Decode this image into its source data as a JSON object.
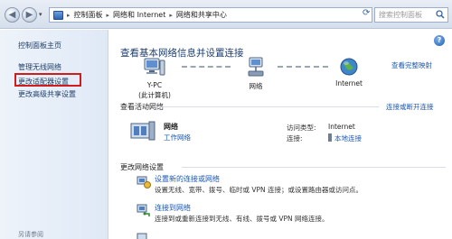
{
  "address_bar": {
    "segments": [
      "控制面板",
      "网络和 Internet",
      "网络和共享中心"
    ],
    "search_placeholder": "搜索控制面板"
  },
  "sidebar": {
    "items": [
      {
        "label": "控制面板主页"
      },
      {
        "label": "管理无线网络"
      },
      {
        "label": "更改适配器设置",
        "highlighted": true
      },
      {
        "label": "更改高级共享设置"
      }
    ],
    "see_also": "另请参阅"
  },
  "main": {
    "title": "查看基本网络信息并设置连接",
    "full_map_link": "查看完整映射",
    "map_nodes": {
      "pc_name": "Y-PC",
      "pc_sub": "(此计算机)",
      "network": "网络",
      "internet": "Internet"
    },
    "active_section": "查看活动网络",
    "disconnect_link": "连接或断开连接",
    "active_network": {
      "name": "网络",
      "type": "工作网络",
      "access_label": "访问类型:",
      "access_value": "Internet",
      "conn_label": "连接:",
      "conn_value": "本地连接"
    },
    "change_section": "更改网络设置",
    "tasks": [
      {
        "title": "设置新的连接或网络",
        "desc": "设置无线、宽带、拨号、临时或 VPN 连接；或设置路由器或访问点。"
      },
      {
        "title": "连接到网络",
        "desc": "连接到或重新连接到无线、有线、拨号或 VPN 网络连接。"
      },
      {
        "title": "",
        "desc": ""
      }
    ]
  },
  "colors": {
    "highlight_border": "#d11c1c",
    "link": "#1a56b0",
    "title": "#1c3d6e"
  }
}
